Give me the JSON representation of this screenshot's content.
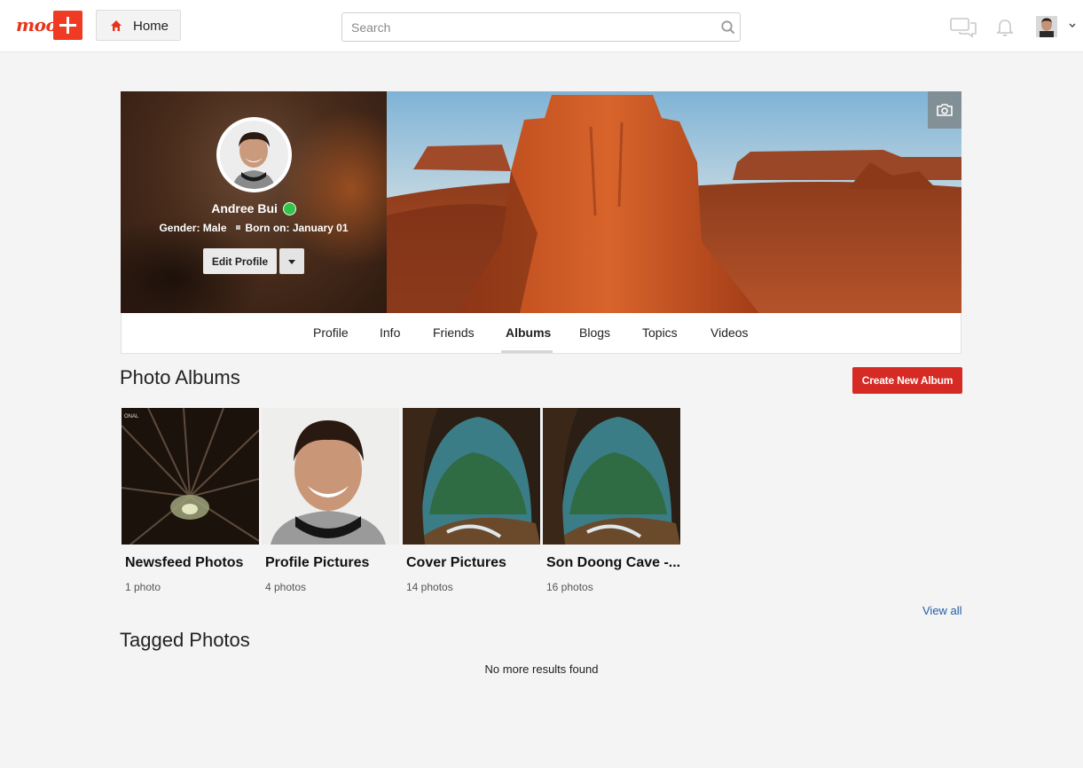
{
  "header": {
    "logo_text": "moo",
    "home_label": "Home",
    "search_placeholder": "Search"
  },
  "profile": {
    "name": "Andree Bui",
    "gender": "Gender: Male",
    "born": "Born on: January 01",
    "edit_label": "Edit Profile",
    "online_color": "#33c34a"
  },
  "tabs": [
    {
      "label": "Profile"
    },
    {
      "label": "Info"
    },
    {
      "label": "Friends"
    },
    {
      "label": "Albums",
      "active": true
    },
    {
      "label": "Blogs"
    },
    {
      "label": "Topics"
    },
    {
      "label": "Videos"
    }
  ],
  "albums_section": {
    "title": "Photo Albums",
    "create_label": "Create New Album",
    "items": [
      {
        "name": "Newsfeed Photos",
        "count": "1 photo"
      },
      {
        "name": "Profile Pictures",
        "count": "4 photos"
      },
      {
        "name": "Cover Pictures",
        "count": "14 photos"
      },
      {
        "name": "Son Doong Cave -...",
        "count": "16 photos"
      }
    ],
    "view_all": "View all"
  },
  "tagged_section": {
    "title": "Tagged Photos",
    "empty_text": "No more results found"
  },
  "colors": {
    "brand": "#ef3b24",
    "create_button": "#d62a24",
    "link": "#1f5ea8"
  }
}
